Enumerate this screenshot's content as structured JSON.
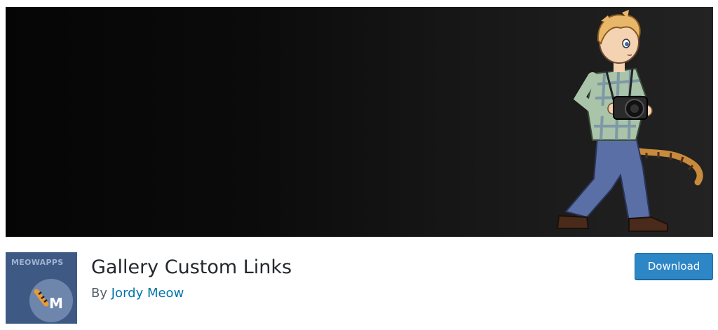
{
  "banner": {
    "illustration": "cartoon-photographer-with-camera-and-tail"
  },
  "plugin": {
    "icon_brand_text": "MEOWAPPS",
    "icon_letter": "M",
    "title": "Gallery Custom Links",
    "by_prefix": "By",
    "author": "Jordy Meow"
  },
  "actions": {
    "download_label": "Download"
  },
  "colors": {
    "link": "#0073aa",
    "download_bg": "#2d86c6",
    "icon_bg": "#3e5a84",
    "banner_dark": "#050505",
    "banner_light": "#232323"
  }
}
